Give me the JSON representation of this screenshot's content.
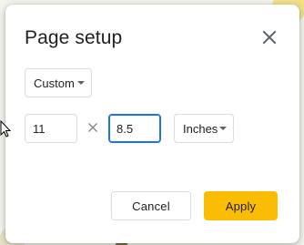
{
  "dialog": {
    "title": "Page setup",
    "preset": {
      "selected": "Custom"
    },
    "size": {
      "width": "11",
      "height": "8.5",
      "unit": "Inches"
    },
    "buttons": {
      "cancel": "Cancel",
      "apply": "Apply"
    },
    "icons": {
      "close": "close-icon",
      "times": "times-icon",
      "dropdown": "chevron-down-icon"
    },
    "colors": {
      "accent": "#fbbc04",
      "focus": "#1a73e8"
    }
  }
}
